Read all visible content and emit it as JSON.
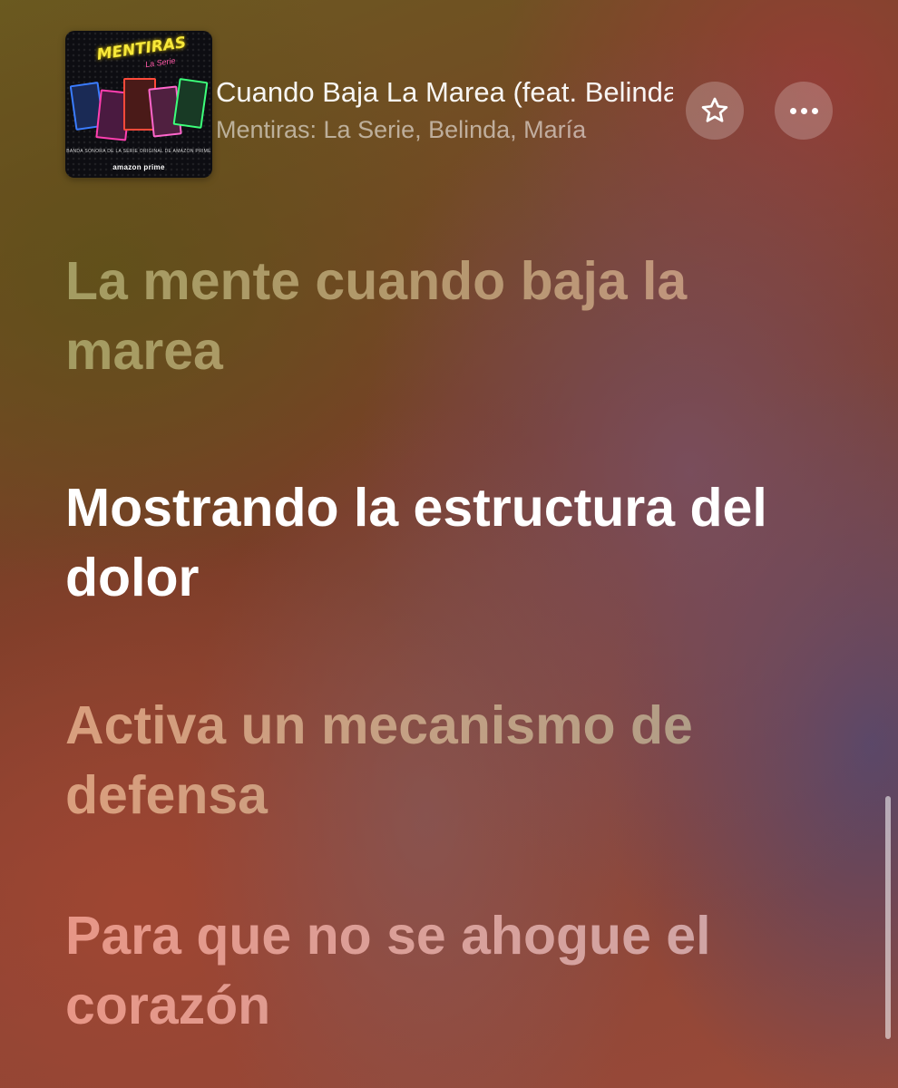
{
  "now_playing": {
    "album_art": {
      "title": "MENTIRAS",
      "subtitle": "La Serie",
      "caption": "BANDA SONORA DE LA SERIE ORIGINAL DE AMAZON PRIME",
      "brand": "amazon prime"
    },
    "song_title": "Cuando Baja La Marea (feat. Belinda)",
    "artist": "Mentiras: La Serie, Belinda, María",
    "favorite_icon": "star-outline-icon",
    "more_icon": "ellipsis-icon"
  },
  "lyrics": {
    "lines": [
      {
        "text": "La mente cuando baja la marea",
        "state": "past"
      },
      {
        "text": "Mostrando la estructura del dolor",
        "state": "current"
      },
      {
        "text": "Activa un mecanismo de defensa",
        "state": "upcoming"
      },
      {
        "text": "Para que no se ahogue el corazón",
        "state": "upcoming"
      }
    ]
  },
  "colors": {
    "current_line": "#ffffff",
    "button_fill": "rgba(255,255,255,0.22)"
  }
}
